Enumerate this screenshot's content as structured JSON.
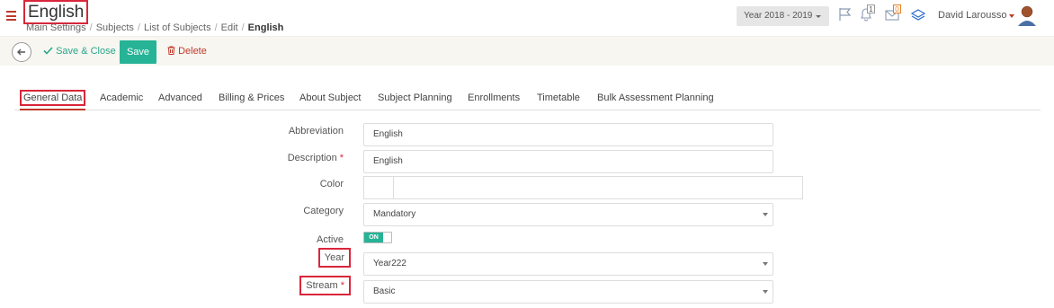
{
  "header": {
    "title": "English",
    "breadcrumb": [
      "Main Settings",
      "Subjects",
      "List of Subjects",
      "Edit",
      "English"
    ],
    "year_selector": "Year 2018 - 2019",
    "notifications_count": "1",
    "messages_count": "0",
    "user_name": "David Larousso"
  },
  "toolbar": {
    "save_close_label": "Save & Close",
    "save_label": "Save",
    "delete_label": "Delete"
  },
  "tabs": [
    {
      "label": "General Data",
      "active": true
    },
    {
      "label": "Academic"
    },
    {
      "label": "Advanced"
    },
    {
      "label": "Billing & Prices"
    },
    {
      "label": "About Subject"
    },
    {
      "label": "Subject Planning"
    },
    {
      "label": "Enrollments"
    },
    {
      "label": "Timetable"
    },
    {
      "label": "Bulk Assessment Planning"
    }
  ],
  "form": {
    "abbreviation": {
      "label": "Abbreviation",
      "value": "English"
    },
    "description": {
      "label": "Description",
      "value": "English",
      "required_mark": "*"
    },
    "color": {
      "label": "Color",
      "value": ""
    },
    "category": {
      "label": "Category",
      "value": "Mandatory"
    },
    "active": {
      "label": "Active",
      "toggle_text": "ON",
      "value": true
    },
    "year": {
      "label": "Year",
      "value": "Year222"
    },
    "stream": {
      "label": "Stream",
      "value": "Basic",
      "required_mark": "*"
    }
  },
  "colors": {
    "accent": "#26b396",
    "brand_red": "#c0392b",
    "highlight_box": "#d9263a"
  }
}
